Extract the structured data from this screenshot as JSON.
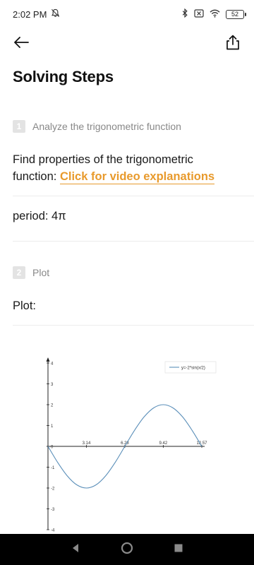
{
  "status_bar": {
    "time": "2:02 PM",
    "battery": "52"
  },
  "page": {
    "title": "Solving Steps"
  },
  "steps": [
    {
      "number": "1",
      "label": "Analyze the trigonometric function",
      "text_line1": "Find properties of the trigonometric",
      "text_prefix": "function: ",
      "link": "Click for video explanations",
      "result": "period: 4π"
    },
    {
      "number": "2",
      "label": "Plot",
      "text": "Plot:"
    }
  ],
  "chart_data": {
    "type": "line",
    "series": [
      {
        "name": "y=-2*sin(x/2)",
        "x": [
          0,
          0.785,
          1.571,
          2.356,
          3.14,
          3.927,
          4.712,
          5.498,
          6.28,
          7.069,
          7.854,
          8.639,
          9.42,
          10.21,
          11.0,
          11.78,
          12.57
        ],
        "y": [
          0,
          -0.765,
          -1.414,
          -1.848,
          -2,
          -1.848,
          -1.414,
          -0.765,
          0,
          0.765,
          1.414,
          1.848,
          2,
          1.848,
          1.414,
          0.765,
          0
        ]
      }
    ],
    "x_ticks": [
      "3.14",
      "6.28",
      "9.42",
      "12.57"
    ],
    "y_ticks": [
      "4",
      "3",
      "2",
      "1",
      "0",
      "-1",
      "-2",
      "-3",
      "-4"
    ],
    "xlim": [
      0,
      12.57
    ],
    "ylim": [
      -4,
      4
    ],
    "line_color": "#5b8fb9",
    "legend_position": "top-right"
  }
}
